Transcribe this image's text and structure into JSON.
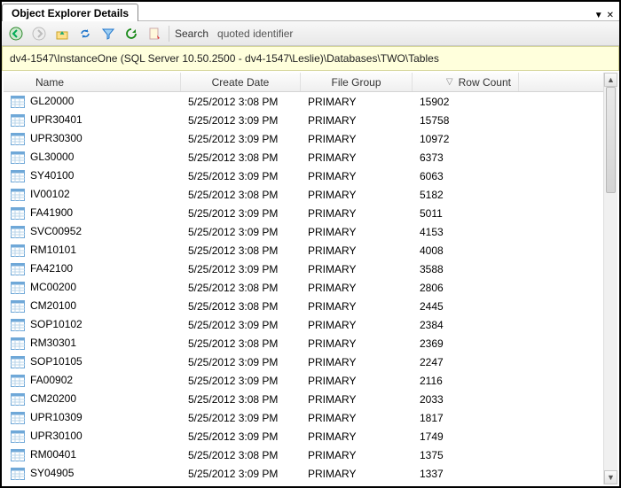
{
  "window": {
    "title": "Object Explorer Details"
  },
  "toolbar": {
    "search_label": "Search",
    "search_value": "quoted identifier"
  },
  "breadcrumb": "dv4-1547\\InstanceOne (SQL Server 10.50.2500 - dv4-1547\\Leslie)\\Databases\\TWO\\Tables",
  "columns": {
    "name": "Name",
    "create_date": "Create Date",
    "file_group": "File Group",
    "row_count": "Row Count"
  },
  "sort": {
    "column": "row_count",
    "dir": "desc"
  },
  "rows": [
    {
      "name": "GL20000",
      "create_date": "5/25/2012 3:08 PM",
      "file_group": "PRIMARY",
      "row_count": "15902"
    },
    {
      "name": "UPR30401",
      "create_date": "5/25/2012 3:09 PM",
      "file_group": "PRIMARY",
      "row_count": "15758"
    },
    {
      "name": "UPR30300",
      "create_date": "5/25/2012 3:09 PM",
      "file_group": "PRIMARY",
      "row_count": "10972"
    },
    {
      "name": "GL30000",
      "create_date": "5/25/2012 3:08 PM",
      "file_group": "PRIMARY",
      "row_count": "6373"
    },
    {
      "name": "SY40100",
      "create_date": "5/25/2012 3:09 PM",
      "file_group": "PRIMARY",
      "row_count": "6063"
    },
    {
      "name": "IV00102",
      "create_date": "5/25/2012 3:08 PM",
      "file_group": "PRIMARY",
      "row_count": "5182"
    },
    {
      "name": "FA41900",
      "create_date": "5/25/2012 3:09 PM",
      "file_group": "PRIMARY",
      "row_count": "5011"
    },
    {
      "name": "SVC00952",
      "create_date": "5/25/2012 3:09 PM",
      "file_group": "PRIMARY",
      "row_count": "4153"
    },
    {
      "name": "RM10101",
      "create_date": "5/25/2012 3:08 PM",
      "file_group": "PRIMARY",
      "row_count": "4008"
    },
    {
      "name": "FA42100",
      "create_date": "5/25/2012 3:09 PM",
      "file_group": "PRIMARY",
      "row_count": "3588"
    },
    {
      "name": "MC00200",
      "create_date": "5/25/2012 3:08 PM",
      "file_group": "PRIMARY",
      "row_count": "2806"
    },
    {
      "name": "CM20100",
      "create_date": "5/25/2012 3:08 PM",
      "file_group": "PRIMARY",
      "row_count": "2445"
    },
    {
      "name": "SOP10102",
      "create_date": "5/25/2012 3:09 PM",
      "file_group": "PRIMARY",
      "row_count": "2384"
    },
    {
      "name": "RM30301",
      "create_date": "5/25/2012 3:08 PM",
      "file_group": "PRIMARY",
      "row_count": "2369"
    },
    {
      "name": "SOP10105",
      "create_date": "5/25/2012 3:09 PM",
      "file_group": "PRIMARY",
      "row_count": "2247"
    },
    {
      "name": "FA00902",
      "create_date": "5/25/2012 3:09 PM",
      "file_group": "PRIMARY",
      "row_count": "2116"
    },
    {
      "name": "CM20200",
      "create_date": "5/25/2012 3:08 PM",
      "file_group": "PRIMARY",
      "row_count": "2033"
    },
    {
      "name": "UPR10309",
      "create_date": "5/25/2012 3:09 PM",
      "file_group": "PRIMARY",
      "row_count": "1817"
    },
    {
      "name": "UPR30100",
      "create_date": "5/25/2012 3:09 PM",
      "file_group": "PRIMARY",
      "row_count": "1749"
    },
    {
      "name": "RM00401",
      "create_date": "5/25/2012 3:08 PM",
      "file_group": "PRIMARY",
      "row_count": "1375"
    },
    {
      "name": "SY04905",
      "create_date": "5/25/2012 3:09 PM",
      "file_group": "PRIMARY",
      "row_count": "1337"
    }
  ]
}
